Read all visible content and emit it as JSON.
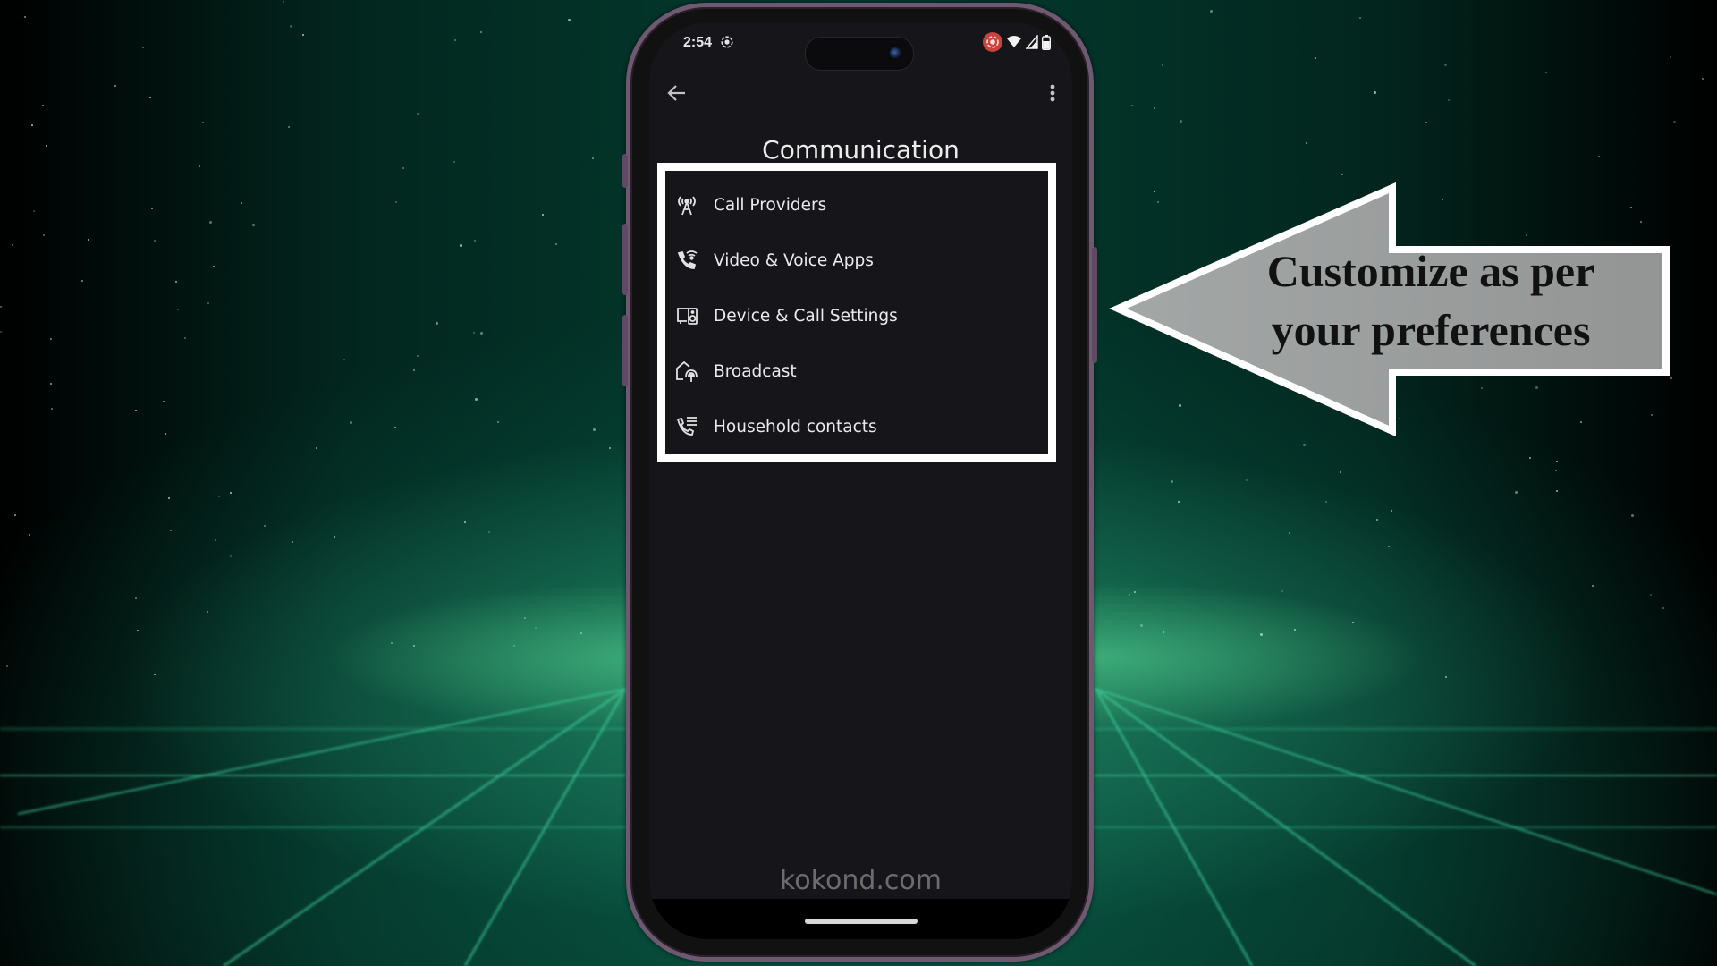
{
  "status_bar": {
    "time": "2:54",
    "left_icons": [
      "screen-record-icon"
    ],
    "right_icons": [
      "recording-badge-icon",
      "wifi-icon",
      "signal-icon",
      "battery-icon"
    ]
  },
  "app_bar": {
    "back_icon": "arrow-back-icon",
    "menu_icon": "more-vert-icon"
  },
  "page": {
    "title": "Communication"
  },
  "menu_items": [
    {
      "label": "Call Providers",
      "icon": "cell-tower-icon"
    },
    {
      "label": "Video & Voice Apps",
      "icon": "wifi-calling-icon"
    },
    {
      "label": "Device & Call Settings",
      "icon": "devices-speaker-icon"
    },
    {
      "label": "Broadcast",
      "icon": "home-broadcast-icon"
    },
    {
      "label": "Household contacts",
      "icon": "contact-phone-list-icon"
    }
  ],
  "watermark": "kokond.com",
  "callout": {
    "line1": "Customize as per",
    "line2": "your preferences",
    "direction": "left"
  },
  "colors": {
    "screen_bg": "#161519",
    "highlight_border": "#ffffff",
    "callout_fill": "#9a9c9c",
    "phone_frame": "#6e5872",
    "recording_badge": "#c9433d",
    "background_accent": "#3fbf85"
  }
}
